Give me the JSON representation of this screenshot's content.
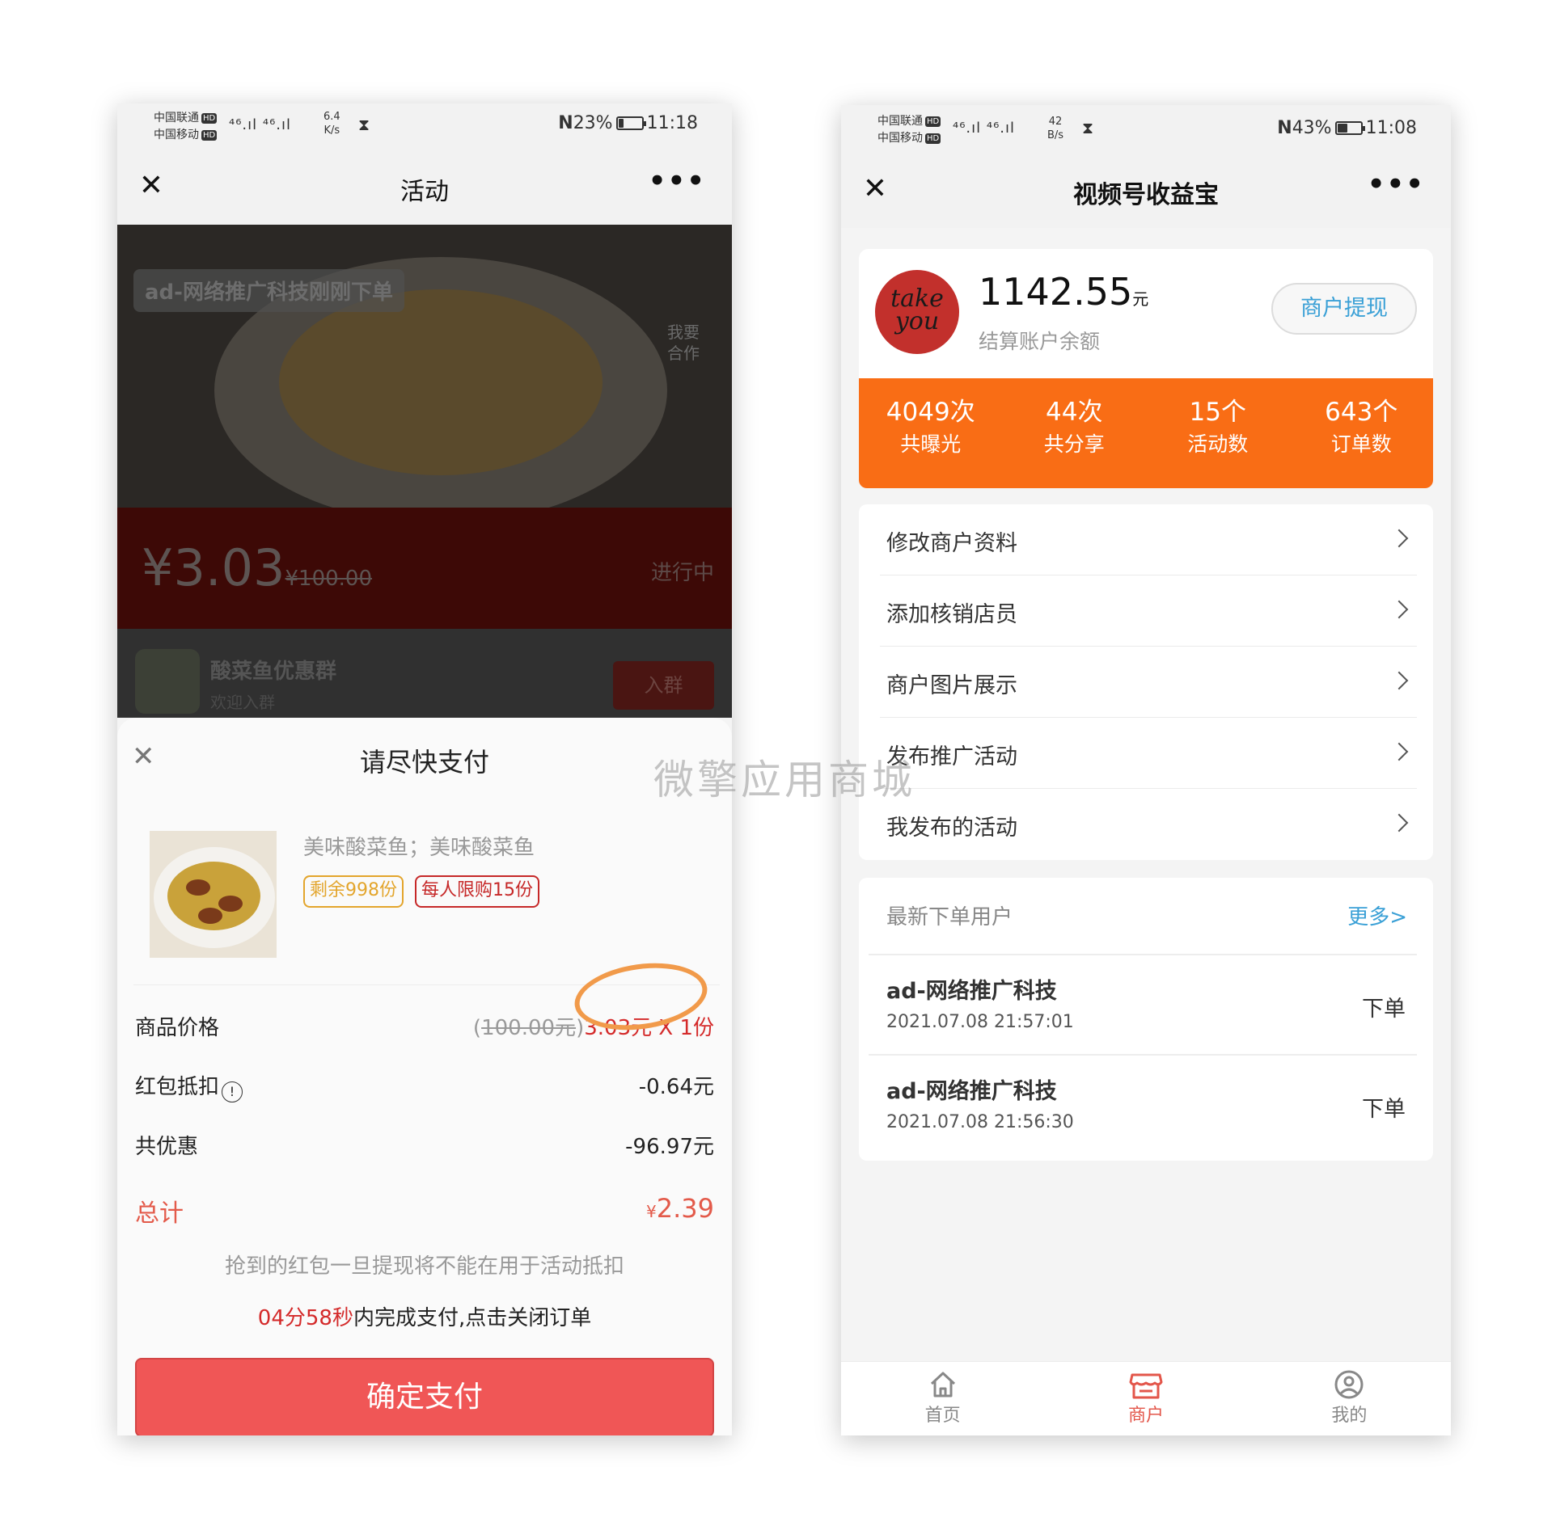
{
  "left": {
    "status": {
      "carrier1": "中国联通",
      "carrier2": "中国移动",
      "hd": "HD",
      "signal": "⁴⁶.ıl ⁴⁶.ıl",
      "speed_value": "6.4",
      "speed_unit": "K/s",
      "nfc": "N",
      "battery": "23%",
      "battery_level": 0.23,
      "time": "11:18"
    },
    "nav": {
      "close": "✕",
      "title": "活动",
      "more": "•••"
    },
    "hero": {
      "badge": "ad-网络推广科技刚刚下单",
      "side_text": "我要合作"
    },
    "price": {
      "current": "¥3.03",
      "original": "¥100.00",
      "status": "进行中"
    },
    "group": {
      "name": "酸菜鱼优惠群",
      "sub": "欢迎入群",
      "join": "入群"
    },
    "sheet": {
      "title": "请尽快支付",
      "product_name": "美味酸菜鱼；美味酸菜鱼",
      "tag_remain": "剩余998份",
      "tag_limit": "每人限购15份",
      "price_label": "商品价格",
      "price_orig": "100.00元",
      "price_value": "3.03元 X 1份",
      "redpack_label": "红包抵扣",
      "redpack_value": "-0.64元",
      "discount_label": "共优惠",
      "discount_value": "-96.97元",
      "total_label": "总计",
      "total_currency": "¥",
      "total_value": "2.39",
      "notice": "抢到的红包一旦提现将不能在用于活动抵扣",
      "countdown_time": "04分58秒",
      "countdown_text": "内完成支付,点击关闭订单",
      "pay_button": "确定支付"
    }
  },
  "watermark": "微擎应用商城",
  "right": {
    "status": {
      "carrier1": "中国联通",
      "carrier2": "中国移动",
      "hd": "HD",
      "signal": "⁴⁶.ıl ⁴⁶.ıl",
      "speed_value": "42",
      "speed_unit": "B/s",
      "nfc": "N",
      "battery": "43%",
      "battery_level": 0.43,
      "time": "11:08"
    },
    "nav": {
      "close": "✕",
      "title": "视频号收益宝",
      "more": "•••"
    },
    "balance": {
      "logo_text": "take you",
      "amount": "1142.55",
      "unit": "元",
      "label": "结算账户余额",
      "withdraw": "商户提现"
    },
    "stats": [
      {
        "value": "4049次",
        "label": "共曝光"
      },
      {
        "value": "44次",
        "label": "共分享"
      },
      {
        "value": "15个",
        "label": "活动数"
      },
      {
        "value": "643个",
        "label": "订单数"
      }
    ],
    "menu": [
      "修改商户资料",
      "添加核销店员",
      "商户图片展示",
      "发布推广活动",
      "我发布的活动"
    ],
    "orders": {
      "title": "最新下单用户",
      "more": "更多>",
      "items": [
        {
          "name": "ad-网络推广科技",
          "time": "2021.07.08 21:57:01",
          "action": "下单"
        },
        {
          "name": "ad-网络推广科技",
          "time": "2021.07.08 21:56:30",
          "action": "下单"
        }
      ]
    },
    "tabs": [
      {
        "label": "首页",
        "icon": "home-icon"
      },
      {
        "label": "商户",
        "icon": "shop-icon"
      },
      {
        "label": "我的",
        "icon": "user-icon"
      }
    ]
  }
}
